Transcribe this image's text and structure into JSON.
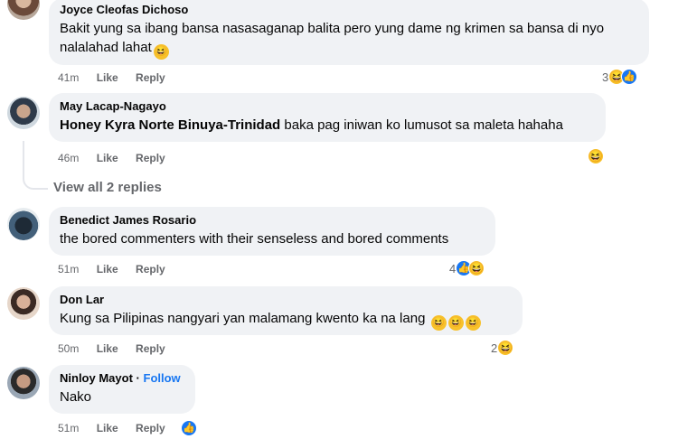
{
  "comments": [
    {
      "author": "Joyce Cleofas Dichoso",
      "text": "Bakit yung sa ibang bansa nasasaganap balita pero yung dame ng krimen sa bansa di nyo nalalahad lahat",
      "time": "41m",
      "like_label": "Like",
      "reply_label": "Reply",
      "reaction_count": "3",
      "reaction_icons": [
        "haha-icon",
        "like-icon"
      ]
    },
    {
      "author": "May Lacap-Nagayo",
      "mention": "Honey Kyra Norte Binuya-Trinidad",
      "text": "baka pag iniwan ko lumusot sa maleta hahaha",
      "time": "46m",
      "like_label": "Like",
      "reply_label": "Reply",
      "reaction_count": "",
      "reaction_icons": [
        "haha-icon"
      ],
      "view_replies": "View all 2 replies"
    },
    {
      "author": "Benedict James Rosario",
      "text": "the bored commenters with their senseless and bored comments",
      "time": "51m",
      "like_label": "Like",
      "reply_label": "Reply",
      "reaction_count": "4",
      "reaction_icons": [
        "like-icon",
        "haha-icon"
      ]
    },
    {
      "author": "Don Lar",
      "text": "Kung sa Pilipinas nangyari yan malamang kwento ka na lang",
      "time": "50m",
      "like_label": "Like",
      "reply_label": "Reply",
      "reaction_count": "2",
      "reaction_icons": [
        "haha-icon"
      ]
    },
    {
      "author": "Ninloy Mayot",
      "follow": "Follow",
      "separator": "·",
      "text": "Nako",
      "time": "51m",
      "like_label": "Like",
      "reply_label": "Reply",
      "reaction_count": "",
      "reaction_icons": [
        "like-icon"
      ]
    }
  ],
  "colors": {
    "bubble": "#f0f2f5",
    "link": "#1877f2",
    "meta": "#65676b",
    "haha": "#f7c12b"
  }
}
